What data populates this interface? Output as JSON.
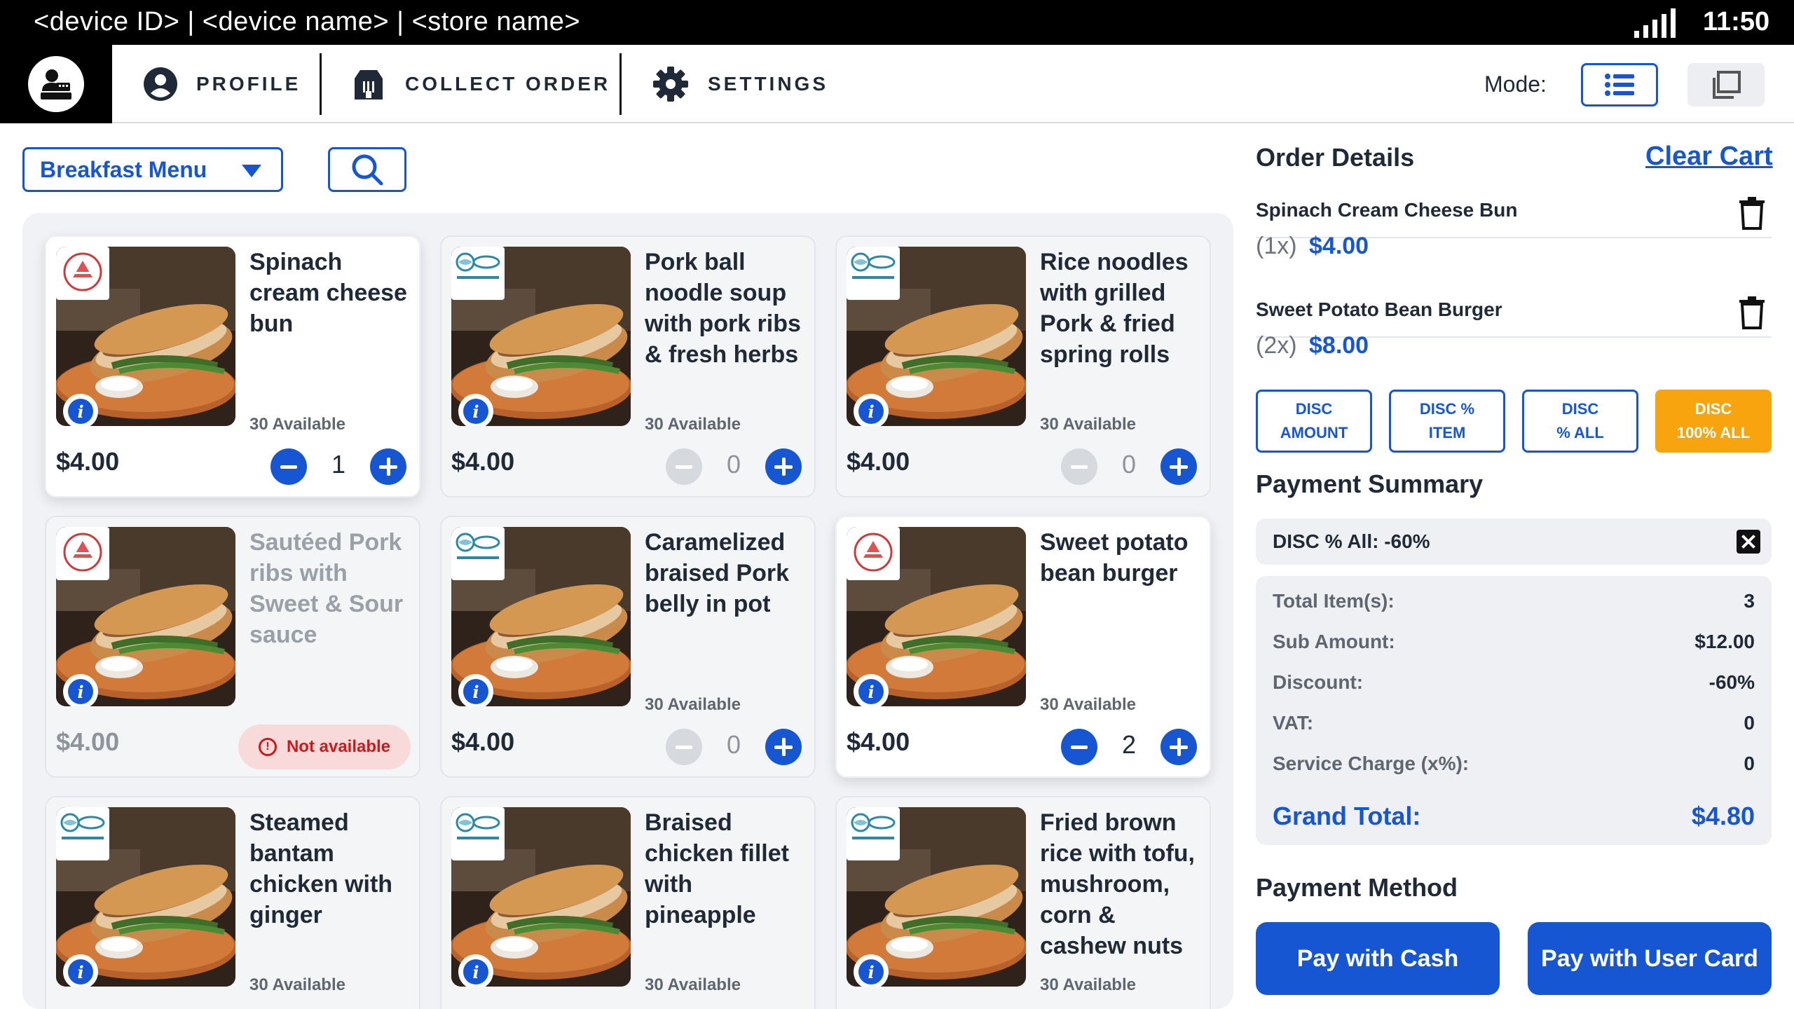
{
  "status_bar": {
    "device_text": "<device ID> | <device name> | <store name>",
    "time": "11:50"
  },
  "nav": {
    "profile": "PROFILE",
    "collect_order": "COLLECT ORDER",
    "settings": "SETTINGS",
    "mode_label": "Mode:"
  },
  "menu": {
    "selected": "Breakfast Menu"
  },
  "products": [
    {
      "name": "Spinach cream cheese bun",
      "available": "30 Available",
      "price": "$4.00",
      "qty": "1",
      "status": "in_cart"
    },
    {
      "name": "Pork ball noodle soup with pork ribs & fresh herbs",
      "available": "30 Available",
      "price": "$4.00",
      "qty": "0",
      "status": "available"
    },
    {
      "name": "Rice noodles with grilled Pork & fried spring rolls",
      "available": "30 Available",
      "price": "$4.00",
      "qty": "0",
      "status": "available"
    },
    {
      "name": "Sautéed Pork ribs with Sweet & Sour sauce",
      "available": "",
      "price": "$4.00",
      "qty": "",
      "status": "unavailable",
      "unavailable_label": "Not available"
    },
    {
      "name": "Caramelized braised Pork belly in pot",
      "available": "30 Available",
      "price": "$4.00",
      "qty": "0",
      "status": "available"
    },
    {
      "name": "Sweet potato bean burger",
      "available": "30 Available",
      "price": "$4.00",
      "qty": "2",
      "status": "in_cart"
    },
    {
      "name": "Steamed bantam chicken with ginger",
      "available": "30 Available",
      "price": "",
      "qty": "",
      "status": "available"
    },
    {
      "name": "Braised chicken fillet with pineapple",
      "available": "30 Available",
      "price": "",
      "qty": "",
      "status": "available"
    },
    {
      "name": "Fried brown rice with tofu, mushroom, corn & cashew nuts",
      "available": "30 Available",
      "price": "",
      "qty": "",
      "status": "available"
    }
  ],
  "order": {
    "title": "Order Details",
    "clear_cart": "Clear Cart",
    "items": [
      {
        "name": "Spinach Cream Cheese Bun",
        "qty": "(1x)",
        "price": "$4.00"
      },
      {
        "name": "Sweet Potato Bean Burger",
        "qty": "(2x)",
        "price": "$8.00"
      }
    ],
    "discount_buttons": [
      {
        "line1": "DISC",
        "line2": "AMOUNT"
      },
      {
        "line1": "DISC %",
        "line2": "ITEM"
      },
      {
        "line1": "DISC",
        "line2": "% ALL"
      },
      {
        "line1": "DISC",
        "line2": "100% ALL"
      }
    ]
  },
  "payment_summary": {
    "title": "Payment Summary",
    "applied_discount": "DISC % All: -60%",
    "rows": [
      {
        "label": "Total Item(s):",
        "value": "3"
      },
      {
        "label": "Sub Amount:",
        "value": "$12.00"
      },
      {
        "label": "Discount:",
        "value": "-60%"
      },
      {
        "label": "VAT:",
        "value": "0"
      },
      {
        "label": "Service Charge (x%):",
        "value": "0"
      }
    ],
    "grand_total_label": "Grand Total:",
    "grand_total_value": "$4.80"
  },
  "payment_method": {
    "title": "Payment Method",
    "cash": "Pay with Cash",
    "card": "Pay with User Card"
  },
  "colors": {
    "primary": "#1756d3",
    "accent": "#f7a40e",
    "danger": "#d01818"
  }
}
